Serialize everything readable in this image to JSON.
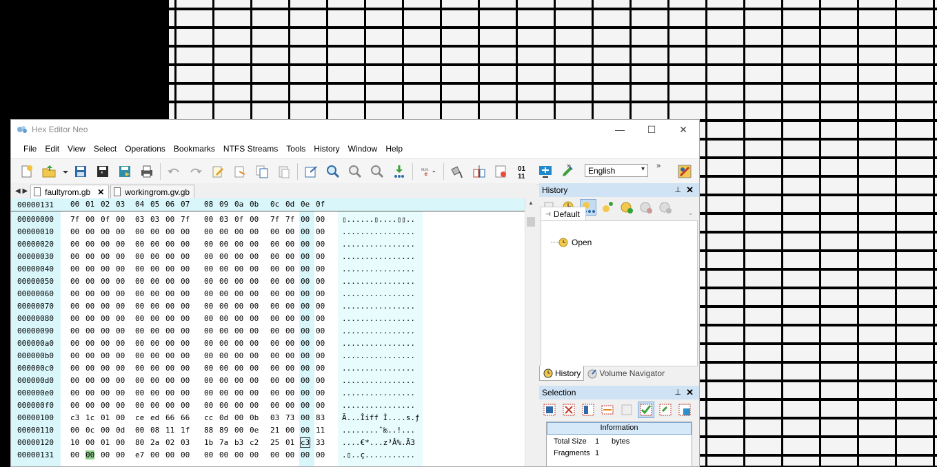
{
  "window": {
    "title": "Hex Editor Neo",
    "min": "—",
    "max": "☐",
    "close": "✕"
  },
  "menu": [
    "File",
    "Edit",
    "View",
    "Select",
    "Operations",
    "Bookmarks",
    "NTFS Streams",
    "Tools",
    "History",
    "Window",
    "Help"
  ],
  "toolbar": {
    "language": "English"
  },
  "tabs": [
    {
      "label": "faultyrom.gb",
      "close": "✕"
    },
    {
      "label": "workingrom.gv.gb"
    }
  ],
  "hex": {
    "current_address": "00000131",
    "columns": [
      "00",
      "01",
      "02",
      "03",
      "04",
      "05",
      "06",
      "07",
      "08",
      "09",
      "0a",
      "0b",
      "0c",
      "0d",
      "0e",
      "0f"
    ],
    "rows": [
      {
        "addr": "00000000",
        "bytes": [
          "7f",
          "00",
          "0f",
          "00",
          "03",
          "03",
          "00",
          "7f",
          "00",
          "03",
          "0f",
          "00",
          "7f",
          "7f",
          "00",
          "00"
        ],
        "ascii": "▯......▯....▯▯.."
      },
      {
        "addr": "00000010",
        "bytes": [
          "00",
          "00",
          "00",
          "00",
          "00",
          "00",
          "00",
          "00",
          "00",
          "00",
          "00",
          "00",
          "00",
          "00",
          "00",
          "00"
        ],
        "ascii": "................"
      },
      {
        "addr": "00000020",
        "bytes": [
          "00",
          "00",
          "00",
          "00",
          "00",
          "00",
          "00",
          "00",
          "00",
          "00",
          "00",
          "00",
          "00",
          "00",
          "00",
          "00"
        ],
        "ascii": "................"
      },
      {
        "addr": "00000030",
        "bytes": [
          "00",
          "00",
          "00",
          "00",
          "00",
          "00",
          "00",
          "00",
          "00",
          "00",
          "00",
          "00",
          "00",
          "00",
          "00",
          "00"
        ],
        "ascii": "................"
      },
      {
        "addr": "00000040",
        "bytes": [
          "00",
          "00",
          "00",
          "00",
          "00",
          "00",
          "00",
          "00",
          "00",
          "00",
          "00",
          "00",
          "00",
          "00",
          "00",
          "00"
        ],
        "ascii": "................"
      },
      {
        "addr": "00000050",
        "bytes": [
          "00",
          "00",
          "00",
          "00",
          "00",
          "00",
          "00",
          "00",
          "00",
          "00",
          "00",
          "00",
          "00",
          "00",
          "00",
          "00"
        ],
        "ascii": "................"
      },
      {
        "addr": "00000060",
        "bytes": [
          "00",
          "00",
          "00",
          "00",
          "00",
          "00",
          "00",
          "00",
          "00",
          "00",
          "00",
          "00",
          "00",
          "00",
          "00",
          "00"
        ],
        "ascii": "................"
      },
      {
        "addr": "00000070",
        "bytes": [
          "00",
          "00",
          "00",
          "00",
          "00",
          "00",
          "00",
          "00",
          "00",
          "00",
          "00",
          "00",
          "00",
          "00",
          "00",
          "00"
        ],
        "ascii": "................"
      },
      {
        "addr": "00000080",
        "bytes": [
          "00",
          "00",
          "00",
          "00",
          "00",
          "00",
          "00",
          "00",
          "00",
          "00",
          "00",
          "00",
          "00",
          "00",
          "00",
          "00"
        ],
        "ascii": "................"
      },
      {
        "addr": "00000090",
        "bytes": [
          "00",
          "00",
          "00",
          "00",
          "00",
          "00",
          "00",
          "00",
          "00",
          "00",
          "00",
          "00",
          "00",
          "00",
          "00",
          "00"
        ],
        "ascii": "................"
      },
      {
        "addr": "000000a0",
        "bytes": [
          "00",
          "00",
          "00",
          "00",
          "00",
          "00",
          "00",
          "00",
          "00",
          "00",
          "00",
          "00",
          "00",
          "00",
          "00",
          "00"
        ],
        "ascii": "................"
      },
      {
        "addr": "000000b0",
        "bytes": [
          "00",
          "00",
          "00",
          "00",
          "00",
          "00",
          "00",
          "00",
          "00",
          "00",
          "00",
          "00",
          "00",
          "00",
          "00",
          "00"
        ],
        "ascii": "................"
      },
      {
        "addr": "000000c0",
        "bytes": [
          "00",
          "00",
          "00",
          "00",
          "00",
          "00",
          "00",
          "00",
          "00",
          "00",
          "00",
          "00",
          "00",
          "00",
          "00",
          "00"
        ],
        "ascii": "................"
      },
      {
        "addr": "000000d0",
        "bytes": [
          "00",
          "00",
          "00",
          "00",
          "00",
          "00",
          "00",
          "00",
          "00",
          "00",
          "00",
          "00",
          "00",
          "00",
          "00",
          "00"
        ],
        "ascii": "................"
      },
      {
        "addr": "000000e0",
        "bytes": [
          "00",
          "00",
          "00",
          "00",
          "00",
          "00",
          "00",
          "00",
          "00",
          "00",
          "00",
          "00",
          "00",
          "00",
          "00",
          "00"
        ],
        "ascii": "................"
      },
      {
        "addr": "000000f0",
        "bytes": [
          "00",
          "00",
          "00",
          "00",
          "00",
          "00",
          "00",
          "00",
          "00",
          "00",
          "00",
          "00",
          "00",
          "00",
          "00",
          "00"
        ],
        "ascii": "................"
      },
      {
        "addr": "00000100",
        "bytes": [
          "c3",
          "1c",
          "01",
          "00",
          "ce",
          "ed",
          "66",
          "66",
          "cc",
          "0d",
          "00",
          "0b",
          "03",
          "73",
          "00",
          "83"
        ],
        "ascii": "Ã...Îíff Ì....s.ƒ"
      },
      {
        "addr": "00000110",
        "bytes": [
          "00",
          "0c",
          "00",
          "0d",
          "00",
          "08",
          "11",
          "1f",
          "88",
          "89",
          "00",
          "0e",
          "21",
          "00",
          "00",
          "11"
        ],
        "ascii": "........ˆ‰..!..."
      },
      {
        "addr": "00000120",
        "bytes": [
          "10",
          "00",
          "01",
          "00",
          "80",
          "2a",
          "02",
          "03",
          "1b",
          "7a",
          "b3",
          "c2",
          "25",
          "01",
          "c3",
          "33"
        ],
        "ascii": "....€*...z³Â%.Ã3"
      },
      {
        "addr": "00000131",
        "bytes": [
          "00",
          "00",
          "00",
          "00",
          "e7",
          "00",
          "00",
          "00",
          "00",
          "00",
          "00",
          "00",
          "00",
          "00",
          "00",
          "00"
        ],
        "ascii": ".▯..ç..........."
      }
    ]
  },
  "history_panel": {
    "title": "History",
    "pin": "📌",
    "close": "✕",
    "tab_default": "Default",
    "node_open": "Open",
    "bottom_tab_history": "History",
    "bottom_tab_volume": "Volume Navigator"
  },
  "selection_panel": {
    "title": "Selection",
    "info_title": "Information",
    "total_size_label": "Total Size",
    "total_size_value": "1",
    "total_size_unit": "bytes",
    "fragments_label": "Fragments",
    "fragments_value": "1"
  },
  "colors": {
    "accent": "#cfe3f5",
    "hex_col": "#d9f6fa",
    "highlight": "#8fd08f"
  }
}
